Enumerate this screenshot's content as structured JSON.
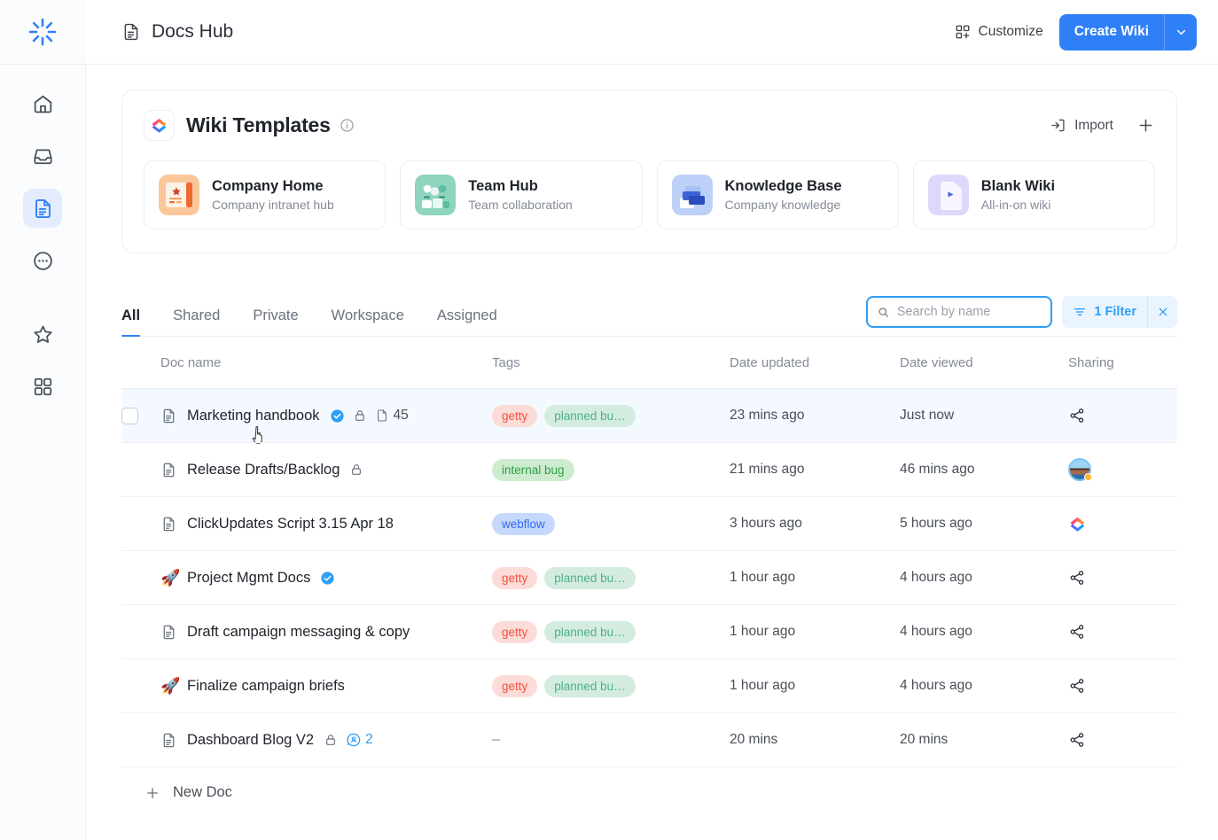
{
  "sidebar": {
    "logo_icon": "spinner-burst-logo",
    "items": [
      {
        "icon": "home-icon",
        "name": "home",
        "active": false
      },
      {
        "icon": "inbox-icon",
        "name": "inbox",
        "active": false
      },
      {
        "icon": "docs-icon",
        "name": "docs",
        "active": true
      },
      {
        "icon": "more-circle-icon",
        "name": "more",
        "active": false
      },
      {
        "icon": "star-icon",
        "name": "favorites",
        "active": false
      },
      {
        "icon": "grid-apps-icon",
        "name": "apps",
        "active": false
      }
    ]
  },
  "topbar": {
    "title": "Docs Hub",
    "title_icon": "document-icon",
    "customize_label": "Customize",
    "customize_icon": "grid-plus-icon",
    "create_wiki_label": "Create Wiki",
    "create_wiki_caret_icon": "chevron-down-icon"
  },
  "templates": {
    "title": "Wiki Templates",
    "brand_icon": "clickup-logo-icon",
    "info_icon": "info-circle-icon",
    "import_label": "Import",
    "import_icon": "import-arrow-icon",
    "add_icon": "plus-icon",
    "cards": [
      {
        "name": "Company Home",
        "desc": "Company intranet hub",
        "icon": "company-home-thumb"
      },
      {
        "name": "Team Hub",
        "desc": "Team collaboration",
        "icon": "team-hub-thumb"
      },
      {
        "name": "Knowledge Base",
        "desc": "Company knowledge",
        "icon": "knowledge-base-thumb"
      },
      {
        "name": "Blank Wiki",
        "desc": "All-in-on wiki",
        "icon": "blank-wiki-thumb"
      }
    ]
  },
  "tabs": [
    {
      "label": "All",
      "active": true
    },
    {
      "label": "Shared",
      "active": false
    },
    {
      "label": "Private",
      "active": false
    },
    {
      "label": "Workspace",
      "active": false
    },
    {
      "label": "Assigned",
      "active": false
    }
  ],
  "search": {
    "placeholder": "Search by name",
    "value": "",
    "icon": "search-icon",
    "filter_label": "1 Filter",
    "filter_icon": "filter-icon",
    "clear_icon": "close-icon"
  },
  "table": {
    "headers": {
      "name": "Doc name",
      "tags": "Tags",
      "updated": "Date updated",
      "viewed": "Date viewed",
      "sharing": "Sharing"
    },
    "rows": [
      {
        "name": "Marketing handbook",
        "icon": "document-icon",
        "verified": true,
        "locked": true,
        "page_count": "45",
        "tags": [
          {
            "text": "getty",
            "color": "red"
          },
          {
            "text": "planned bu…",
            "color": "green"
          }
        ],
        "updated": "23 mins ago",
        "viewed": "Just now",
        "sharing": "share-icon",
        "selected": true,
        "checkbox": true
      },
      {
        "name": "Release Drafts/Backlog",
        "icon": "document-icon",
        "verified": false,
        "locked": true,
        "page_count": "",
        "tags": [
          {
            "text": "internal bug",
            "color": "green-solid"
          }
        ],
        "updated": "21 mins ago",
        "viewed": "46 mins ago",
        "sharing": "avatar",
        "selected": false,
        "checkbox": false
      },
      {
        "name": "ClickUpdates Script 3.15 Apr 18",
        "icon": "document-icon",
        "verified": false,
        "locked": false,
        "page_count": "",
        "tags": [
          {
            "text": "webflow",
            "color": "blue"
          }
        ],
        "updated": "3 hours ago",
        "viewed": "5 hours ago",
        "sharing": "clickup-logo-icon",
        "selected": false,
        "checkbox": false
      },
      {
        "name": "Project Mgmt Docs",
        "icon": "rocket-icon",
        "verified": true,
        "locked": false,
        "page_count": "",
        "tags": [
          {
            "text": "getty",
            "color": "red"
          },
          {
            "text": "planned bu…",
            "color": "green"
          }
        ],
        "updated": "1 hour ago",
        "viewed": "4 hours ago",
        "sharing": "share-icon",
        "selected": false,
        "checkbox": false
      },
      {
        "name": "Draft campaign messaging & copy",
        "icon": "document-icon",
        "verified": false,
        "locked": false,
        "page_count": "",
        "tags": [
          {
            "text": "getty",
            "color": "red"
          },
          {
            "text": "planned bu…",
            "color": "green"
          }
        ],
        "updated": "1 hour ago",
        "viewed": "4 hours ago",
        "sharing": "share-icon",
        "selected": false,
        "checkbox": false
      },
      {
        "name": "Finalize campaign briefs",
        "icon": "rocket-icon",
        "verified": false,
        "locked": false,
        "page_count": "",
        "tags": [
          {
            "text": "getty",
            "color": "red"
          },
          {
            "text": "planned bu…",
            "color": "green"
          }
        ],
        "updated": "1 hour ago",
        "viewed": "4 hours ago",
        "sharing": "share-icon",
        "selected": false,
        "checkbox": false
      },
      {
        "name": "Dashboard Blog V2",
        "icon": "document-icon",
        "verified": false,
        "locked": true,
        "page_count": "",
        "mentions": "2",
        "tags": [],
        "tags_empty": "–",
        "updated": "20 mins",
        "viewed": "20 mins",
        "sharing": "share-icon",
        "selected": false,
        "checkbox": false
      }
    ],
    "new_doc_label": "New Doc",
    "new_doc_icon": "plus-icon"
  },
  "colors": {
    "accent": "#2f80f7",
    "accent_light": "#2f9ef7",
    "tag_red_bg": "#fcdcd8",
    "tag_red_fg": "#f2503f",
    "tag_green_bg": "#d4ecdf",
    "tag_green_fg": "#4bb18a",
    "tag_green_solid_bg": "#cdeccf",
    "tag_green_solid_fg": "#2f9e44",
    "tag_blue_bg": "#c6d8fb",
    "tag_blue_fg": "#2f6bf7",
    "row_highlight": "#f3f9ff"
  }
}
